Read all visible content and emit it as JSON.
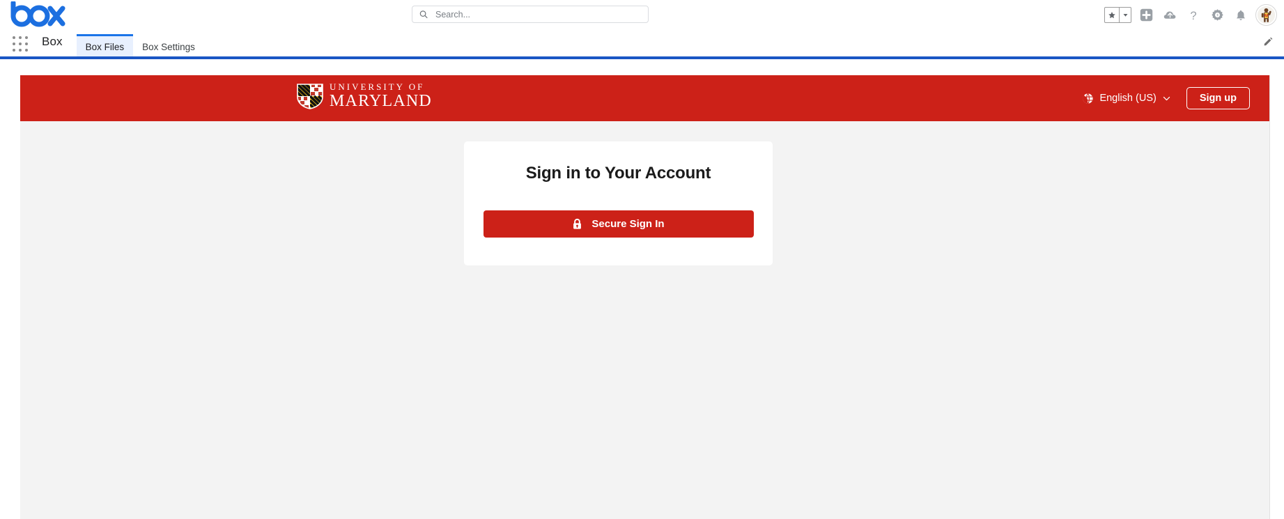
{
  "browser": {
    "logo_text": "box",
    "apps_grid_icon": "grid-dots-icon",
    "app_name": "Box",
    "tabs": [
      {
        "label": "Box Files",
        "active": true
      },
      {
        "label": "Box Settings",
        "active": false
      }
    ],
    "search": {
      "placeholder": "Search...",
      "value": "",
      "icon": "search-icon"
    },
    "toolbar_icons": [
      "bookmark-star-icon",
      "bookmark-dropdown-icon",
      "add-plus-icon",
      "cloud-upload-icon",
      "help-question-icon",
      "settings-gear-icon",
      "notifications-bell-icon"
    ],
    "avatar": "user-avatar-terrapin",
    "edit_icon": "pencil-edit-icon"
  },
  "banner": {
    "logo_line1": "UNIVERSITY OF",
    "logo_line2": "MARYLAND",
    "logo_shield_icon": "maryland-flag-shield-icon",
    "language": {
      "label": "English (US)",
      "globe_icon": "globe-icon",
      "chevron_icon": "chevron-down-icon"
    },
    "signup_label": "Sign up"
  },
  "signin_card": {
    "title": "Sign in to Your Account",
    "button_label": "Secure Sign In",
    "button_icon": "lock-icon"
  },
  "colors": {
    "umd_red": "#cc2118",
    "chrome_blue": "#1a56c4",
    "tab_accent": "#1a73e8",
    "page_bg": "#f3f3f3",
    "box_blue": "#1c6fe0"
  }
}
